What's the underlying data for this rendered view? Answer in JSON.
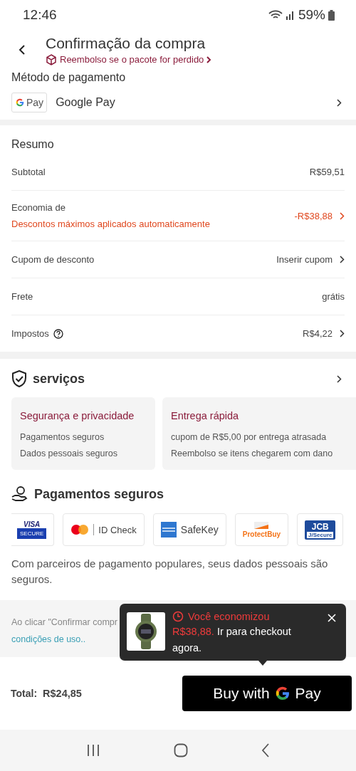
{
  "status_bar": {
    "time": "12:46",
    "battery": "59%"
  },
  "header": {
    "title": "Confirmação da compra",
    "subtitle": "Reembolso se o pacote for perdido"
  },
  "payment_method": {
    "section_title": "Método de pagamento",
    "logo_text": "Pay",
    "name": "Google Pay"
  },
  "summary": {
    "title": "Resumo",
    "rows": [
      {
        "label": "Subtotal",
        "value": "R$59,51",
        "accent": false,
        "chevron": false,
        "help": false
      },
      {
        "label": "Economia de",
        "sublabel": "Descontos máximos aplicados automaticamente",
        "value": "-R$38,88",
        "accent": true,
        "chevron": true,
        "help": false
      },
      {
        "label": "Cupom de desconto",
        "value": "Inserir cupom",
        "accent": false,
        "chevron": true,
        "help": false
      },
      {
        "label": "Frete",
        "value": "grátis",
        "accent": false,
        "chevron": false,
        "help": false
      },
      {
        "label": "Impostos",
        "value": "R$4,22",
        "accent": false,
        "chevron": true,
        "help": true
      }
    ]
  },
  "services": {
    "title": "serviços",
    "cards": [
      {
        "title": "Segurança e privacidade",
        "lines": [
          "Pagamentos seguros",
          "Dados pessoais seguros"
        ]
      },
      {
        "title": "Entrega rápida",
        "lines": [
          "cupom de R$5,00 por entrega atrasada",
          "Reembolso se itens chegarem com dano"
        ]
      }
    ]
  },
  "secure_payments": {
    "title": "Pagamentos seguros",
    "partners": [
      {
        "kind": "visa",
        "label": "VISA",
        "sub": "SECURE"
      },
      {
        "kind": "mastercard",
        "label": "ID Check"
      },
      {
        "kind": "amex",
        "label": "SafeKey"
      },
      {
        "kind": "discover",
        "label": "ProtectBuy"
      },
      {
        "kind": "jcb",
        "label": "JCB",
        "sub": "J/Secure"
      }
    ],
    "note": "Com parceiros de pagamento populares, seus dados pessoais são seguros."
  },
  "legal": {
    "text": "Ao clicar \"Confirmar compr",
    "link": "condições de uso.."
  },
  "tooltip": {
    "title": "Você economizou",
    "amount": "R$38,88.",
    "message": "Ir para checkout agora."
  },
  "footer": {
    "total_label": "Total:",
    "total": "R$24,85",
    "button_text": "Buy with",
    "button_brand": "Pay"
  }
}
